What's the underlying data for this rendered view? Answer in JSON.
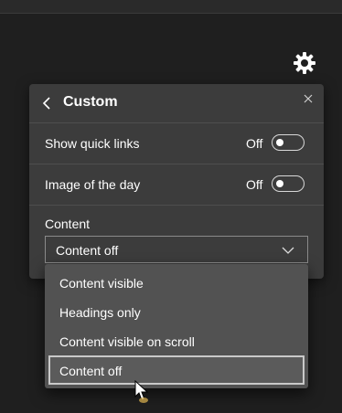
{
  "header": {
    "settings_icon": "gear-icon"
  },
  "panel": {
    "title": "Custom",
    "back_icon": "chevron-left-icon",
    "close_icon": "close-icon",
    "rows": [
      {
        "label": "Show quick links",
        "state": "Off"
      },
      {
        "label": "Image of the day",
        "state": "Off"
      }
    ],
    "content_label": "Content",
    "content_select": {
      "value": "Content off",
      "options": [
        "Content visible",
        "Headings only",
        "Content visible on scroll",
        "Content off"
      ],
      "selected_index": 3
    }
  }
}
